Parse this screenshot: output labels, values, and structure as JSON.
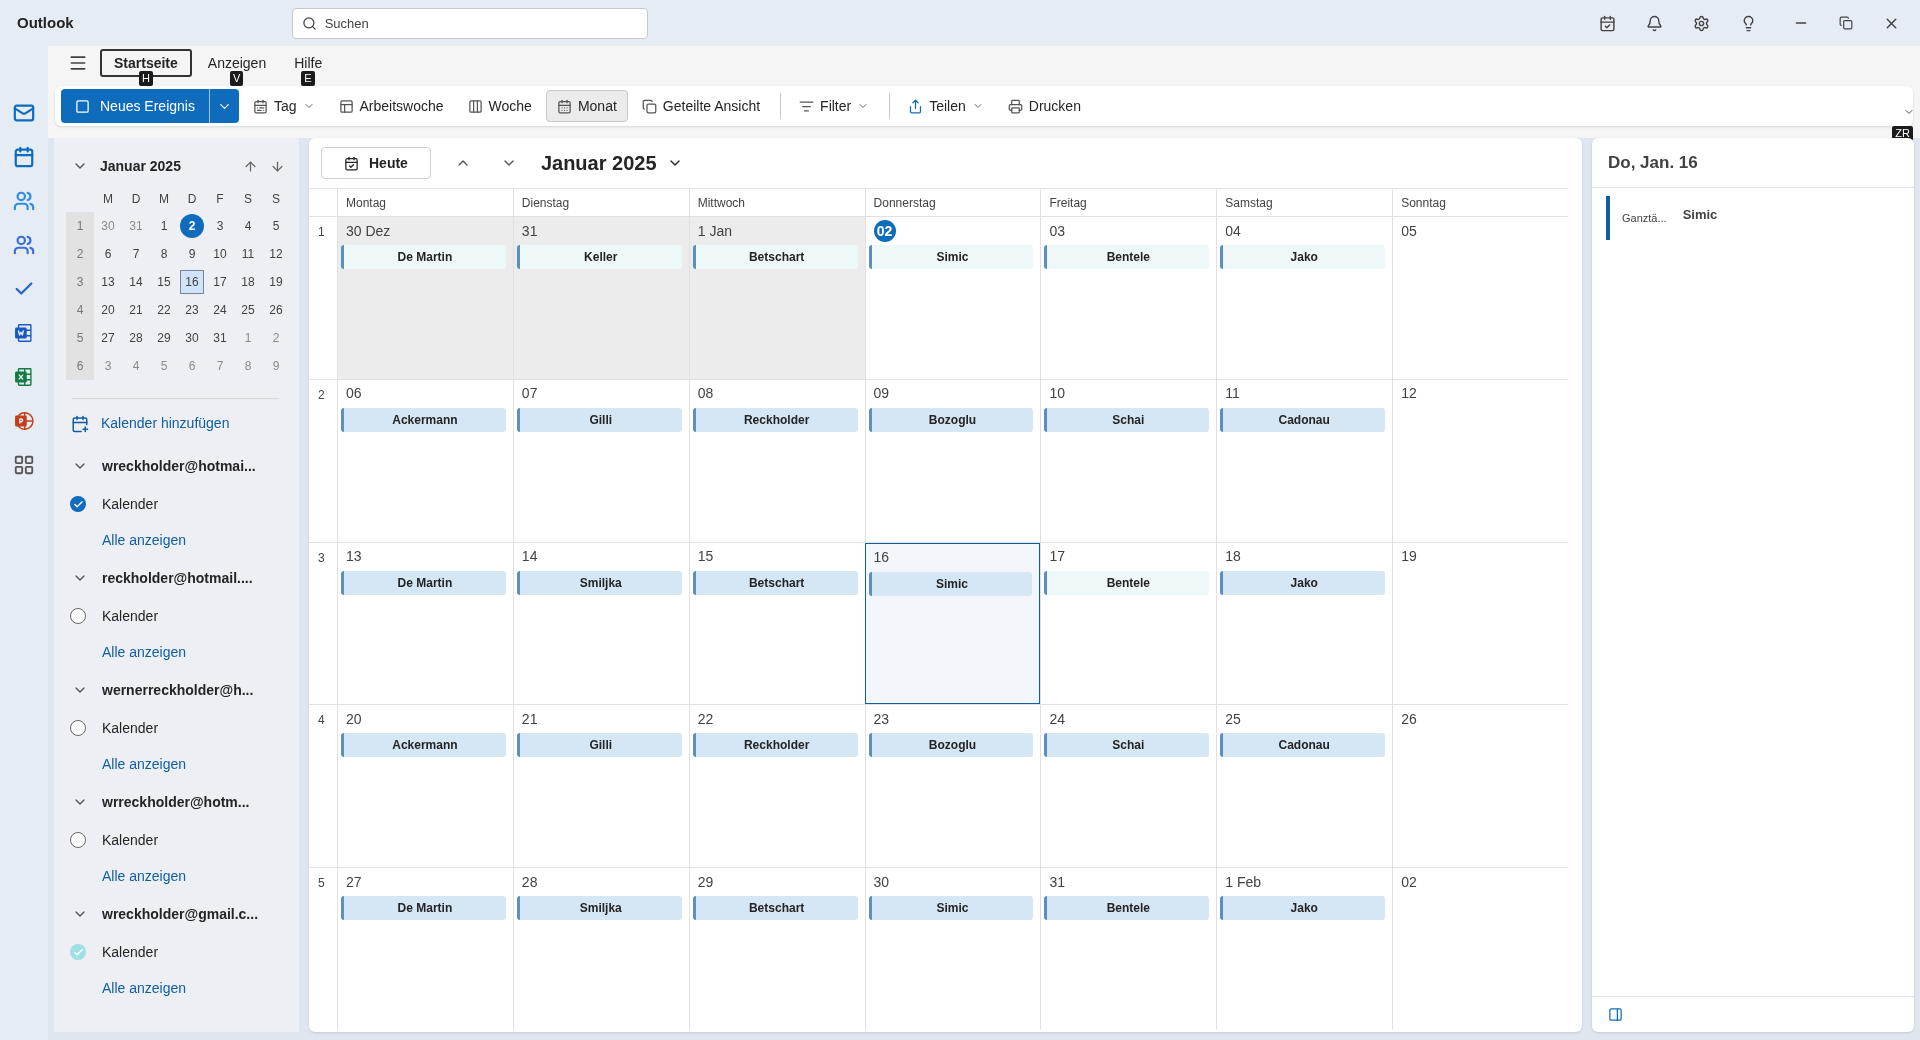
{
  "app": {
    "title": "Outlook"
  },
  "search": {
    "placeholder": "Suchen"
  },
  "ribbon": {
    "tabs": [
      {
        "label": "Startseite",
        "selected": true,
        "keytip": "H"
      },
      {
        "label": "Anzeigen",
        "selected": false,
        "keytip": "V"
      },
      {
        "label": "Hilfe",
        "selected": false,
        "keytip": "E"
      }
    ],
    "collapse_keytip": "ZR"
  },
  "toolbar": {
    "new_event": {
      "label": "Neues Ereignis"
    },
    "items": [
      {
        "label": "Tag",
        "kind": "dropdown",
        "selected": false,
        "divider_before": false
      },
      {
        "label": "Arbeitswoche",
        "kind": "button",
        "selected": false,
        "divider_before": false
      },
      {
        "label": "Woche",
        "kind": "button",
        "selected": false,
        "divider_before": false
      },
      {
        "label": "Monat",
        "kind": "button",
        "selected": true,
        "divider_before": false
      },
      {
        "label": "Geteilte Ansicht",
        "kind": "button",
        "selected": false,
        "divider_before": false
      },
      {
        "label": "Filter",
        "kind": "dropdown",
        "selected": false,
        "divider_before": true
      },
      {
        "label": "Teilen",
        "kind": "dropdown",
        "selected": false,
        "divider_before": true
      },
      {
        "label": "Drucken",
        "kind": "button",
        "selected": false,
        "divider_before": false
      }
    ]
  },
  "mini_calendar": {
    "title": "Januar 2025",
    "weekdays": [
      "M",
      "D",
      "M",
      "D",
      "F",
      "S",
      "S"
    ],
    "weeks": [
      {
        "number": "1",
        "days": [
          {
            "label": "30",
            "muted": true,
            "today": false,
            "selected": false
          },
          {
            "label": "31",
            "muted": true,
            "today": false,
            "selected": false
          },
          {
            "label": "1",
            "muted": false,
            "today": false,
            "selected": false
          },
          {
            "label": "2",
            "muted": false,
            "today": true,
            "selected": false
          },
          {
            "label": "3",
            "muted": false,
            "today": false,
            "selected": false
          },
          {
            "label": "4",
            "muted": false,
            "today": false,
            "selected": false
          },
          {
            "label": "5",
            "muted": false,
            "today": false,
            "selected": false
          }
        ]
      },
      {
        "number": "2",
        "days": [
          {
            "label": "6",
            "muted": false,
            "today": false,
            "selected": false
          },
          {
            "label": "7",
            "muted": false,
            "today": false,
            "selected": false
          },
          {
            "label": "8",
            "muted": false,
            "today": false,
            "selected": false
          },
          {
            "label": "9",
            "muted": false,
            "today": false,
            "selected": false
          },
          {
            "label": "10",
            "muted": false,
            "today": false,
            "selected": false
          },
          {
            "label": "11",
            "muted": false,
            "today": false,
            "selected": false
          },
          {
            "label": "12",
            "muted": false,
            "today": false,
            "selected": false
          }
        ]
      },
      {
        "number": "3",
        "days": [
          {
            "label": "13",
            "muted": false,
            "today": false,
            "selected": false
          },
          {
            "label": "14",
            "muted": false,
            "today": false,
            "selected": false
          },
          {
            "label": "15",
            "muted": false,
            "today": false,
            "selected": false
          },
          {
            "label": "16",
            "muted": false,
            "today": false,
            "selected": true
          },
          {
            "label": "17",
            "muted": false,
            "today": false,
            "selected": false
          },
          {
            "label": "18",
            "muted": false,
            "today": false,
            "selected": false
          },
          {
            "label": "19",
            "muted": false,
            "today": false,
            "selected": false
          }
        ]
      },
      {
        "number": "4",
        "days": [
          {
            "label": "20",
            "muted": false,
            "today": false,
            "selected": false
          },
          {
            "label": "21",
            "muted": false,
            "today": false,
            "selected": false
          },
          {
            "label": "22",
            "muted": false,
            "today": false,
            "selected": false
          },
          {
            "label": "23",
            "muted": false,
            "today": false,
            "selected": false
          },
          {
            "label": "24",
            "muted": false,
            "today": false,
            "selected": false
          },
          {
            "label": "25",
            "muted": false,
            "today": false,
            "selected": false
          },
          {
            "label": "26",
            "muted": false,
            "today": false,
            "selected": false
          }
        ]
      },
      {
        "number": "5",
        "days": [
          {
            "label": "27",
            "muted": false,
            "today": false,
            "selected": false
          },
          {
            "label": "28",
            "muted": false,
            "today": false,
            "selected": false
          },
          {
            "label": "29",
            "muted": false,
            "today": false,
            "selected": false
          },
          {
            "label": "30",
            "muted": false,
            "today": false,
            "selected": false
          },
          {
            "label": "31",
            "muted": false,
            "today": false,
            "selected": false
          },
          {
            "label": "1",
            "muted": true,
            "today": false,
            "selected": false
          },
          {
            "label": "2",
            "muted": true,
            "today": false,
            "selected": false
          }
        ]
      },
      {
        "number": "6",
        "days": [
          {
            "label": "3",
            "muted": true,
            "today": false,
            "selected": false
          },
          {
            "label": "4",
            "muted": true,
            "today": false,
            "selected": false
          },
          {
            "label": "5",
            "muted": true,
            "today": false,
            "selected": false
          },
          {
            "label": "6",
            "muted": true,
            "today": false,
            "selected": false
          },
          {
            "label": "7",
            "muted": true,
            "today": false,
            "selected": false
          },
          {
            "label": "8",
            "muted": true,
            "today": false,
            "selected": false
          },
          {
            "label": "9",
            "muted": true,
            "today": false,
            "selected": false
          }
        ]
      }
    ]
  },
  "add_calendar": "Kalender hinzufügen",
  "accounts": [
    {
      "email": "wreckholder@hotmai...",
      "expanded": true,
      "calendars": [
        {
          "name": "Kalender",
          "checked": true,
          "color": "#0f6cbd"
        }
      ],
      "show_all": "Alle anzeigen"
    },
    {
      "email": "reckholder@hotmail....",
      "expanded": true,
      "calendars": [
        {
          "name": "Kalender",
          "checked": false
        }
      ],
      "show_all": "Alle anzeigen"
    },
    {
      "email": "wernerreckholder@h...",
      "expanded": true,
      "calendars": [
        {
          "name": "Kalender",
          "checked": false
        }
      ],
      "show_all": "Alle anzeigen"
    },
    {
      "email": "wrreckholder@hotm...",
      "expanded": true,
      "calendars": [
        {
          "name": "Kalender",
          "checked": false
        }
      ],
      "show_all": "Alle anzeigen"
    },
    {
      "email": "wreckholder@gmail.c...",
      "expanded": true,
      "calendars": [
        {
          "name": "Kalender",
          "checked": true,
          "color": "#9fe0e3"
        }
      ],
      "show_all": "Alle anzeigen"
    }
  ],
  "calendar": {
    "today_button": "Heute",
    "title": "Januar 2025",
    "weekdays": [
      "Montag",
      "Dienstag",
      "Mittwoch",
      "Donnerstag",
      "Freitag",
      "Samstag",
      "Sonntag"
    ],
    "weeks": [
      {
        "number": "1",
        "days": [
          {
            "date": "30 Dez",
            "today": false,
            "selected": false,
            "shaded": true,
            "event": {
              "title": "De Martin",
              "color": "#eef8f8"
            }
          },
          {
            "date": "31",
            "today": false,
            "selected": false,
            "shaded": true,
            "event": {
              "title": "Keller",
              "color": "#eef8f8"
            }
          },
          {
            "date": "1 Jan",
            "today": false,
            "selected": false,
            "shaded": true,
            "event": {
              "title": "Betschart",
              "color": "#eef8f8"
            }
          },
          {
            "date": "02",
            "today": true,
            "selected": false,
            "shaded": false,
            "event": {
              "title": "Simic",
              "color": "#eef8f8"
            }
          },
          {
            "date": "03",
            "today": false,
            "selected": false,
            "shaded": false,
            "event": {
              "title": "Bentele",
              "color": "#eef8f8"
            }
          },
          {
            "date": "04",
            "today": false,
            "selected": false,
            "shaded": false,
            "event": {
              "title": "Jako",
              "color": "#eef8f8"
            }
          },
          {
            "date": "05",
            "today": false,
            "selected": false,
            "shaded": false
          }
        ]
      },
      {
        "number": "2",
        "days": [
          {
            "date": "06",
            "today": false,
            "selected": false,
            "shaded": false,
            "event": {
              "title": "Ackermann",
              "color": "#d5e6f5"
            }
          },
          {
            "date": "07",
            "today": false,
            "selected": false,
            "shaded": false,
            "event": {
              "title": "Gilli",
              "color": "#d5e6f5"
            }
          },
          {
            "date": "08",
            "today": false,
            "selected": false,
            "shaded": false,
            "event": {
              "title": "Reckholder",
              "color": "#d5e6f5"
            }
          },
          {
            "date": "09",
            "today": false,
            "selected": false,
            "shaded": false,
            "event": {
              "title": "Bozoglu",
              "color": "#d5e6f5"
            }
          },
          {
            "date": "10",
            "today": false,
            "selected": false,
            "shaded": false,
            "event": {
              "title": "Schai",
              "color": "#d5e6f5"
            }
          },
          {
            "date": "11",
            "today": false,
            "selected": false,
            "shaded": false,
            "event": {
              "title": "Cadonau",
              "color": "#d5e6f5"
            }
          },
          {
            "date": "12",
            "today": false,
            "selected": false,
            "shaded": false
          }
        ]
      },
      {
        "number": "3",
        "days": [
          {
            "date": "13",
            "today": false,
            "selected": false,
            "shaded": false,
            "event": {
              "title": "De Martin",
              "color": "#d5e6f5"
            }
          },
          {
            "date": "14",
            "today": false,
            "selected": false,
            "shaded": false,
            "event": {
              "title": "Smiljka",
              "color": "#d5e6f5"
            }
          },
          {
            "date": "15",
            "today": false,
            "selected": false,
            "shaded": false,
            "event": {
              "title": "Betschart",
              "color": "#d5e6f5"
            }
          },
          {
            "date": "16",
            "today": false,
            "selected": true,
            "shaded": false,
            "event": {
              "title": "Simic",
              "color": "#d5e6f5"
            }
          },
          {
            "date": "17",
            "today": false,
            "selected": false,
            "shaded": false,
            "event": {
              "title": "Bentele",
              "color": "#eef8f8"
            }
          },
          {
            "date": "18",
            "today": false,
            "selected": false,
            "shaded": false,
            "event": {
              "title": "Jako",
              "color": "#d5e6f5"
            }
          },
          {
            "date": "19",
            "today": false,
            "selected": false,
            "shaded": false
          }
        ]
      },
      {
        "number": "4",
        "days": [
          {
            "date": "20",
            "today": false,
            "selected": false,
            "shaded": false,
            "event": {
              "title": "Ackermann",
              "color": "#d5e6f5"
            }
          },
          {
            "date": "21",
            "today": false,
            "selected": false,
            "shaded": false,
            "event": {
              "title": "Gilli",
              "color": "#d5e6f5"
            }
          },
          {
            "date": "22",
            "today": false,
            "selected": false,
            "shaded": false,
            "event": {
              "title": "Reckholder",
              "color": "#d5e6f5"
            }
          },
          {
            "date": "23",
            "today": false,
            "selected": false,
            "shaded": false,
            "event": {
              "title": "Bozoglu",
              "color": "#d5e6f5"
            }
          },
          {
            "date": "24",
            "today": false,
            "selected": false,
            "shaded": false,
            "event": {
              "title": "Schai",
              "color": "#d5e6f5"
            }
          },
          {
            "date": "25",
            "today": false,
            "selected": false,
            "shaded": false,
            "event": {
              "title": "Cadonau",
              "color": "#d5e6f5"
            }
          },
          {
            "date": "26",
            "today": false,
            "selected": false,
            "shaded": false
          }
        ]
      },
      {
        "number": "5",
        "days": [
          {
            "date": "27",
            "today": false,
            "selected": false,
            "shaded": false,
            "event": {
              "title": "De Martin",
              "color": "#d5e6f5"
            }
          },
          {
            "date": "28",
            "today": false,
            "selected": false,
            "shaded": false,
            "event": {
              "title": "Smiljka",
              "color": "#d5e6f5"
            }
          },
          {
            "date": "29",
            "today": false,
            "selected": false,
            "shaded": false,
            "event": {
              "title": "Betschart",
              "color": "#d5e6f5"
            }
          },
          {
            "date": "30",
            "today": false,
            "selected": false,
            "shaded": false,
            "event": {
              "title": "Simic",
              "color": "#d5e6f5"
            }
          },
          {
            "date": "31",
            "today": false,
            "selected": false,
            "shaded": false,
            "event": {
              "title": "Bentele",
              "color": "#d5e6f5"
            }
          },
          {
            "date": "1 Feb",
            "today": false,
            "selected": false,
            "shaded": false,
            "event": {
              "title": "Jako",
              "color": "#d5e6f5"
            }
          },
          {
            "date": "02",
            "today": false,
            "selected": false,
            "shaded": false
          }
        ]
      }
    ]
  },
  "day_panel": {
    "title": "Do, Jan. 16",
    "events": [
      {
        "time": "Ganztä...",
        "title": "Simic"
      }
    ]
  }
}
